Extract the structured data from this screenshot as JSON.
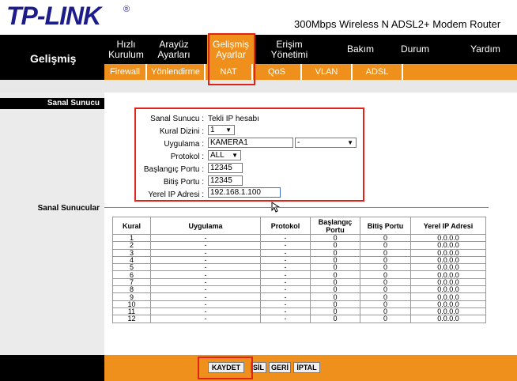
{
  "header": {
    "logo": "TP-LINK",
    "logo_mark": "®",
    "product": "300Mbps Wireless N ADSL2+ Modem Router"
  },
  "nav": {
    "section": "Gelişmiş",
    "items": [
      {
        "label": "Hızlı Kurulum"
      },
      {
        "label": "Arayüz Ayarları"
      },
      {
        "label": "Gelişmiş Ayarlar"
      },
      {
        "label": "Erişim Yönetimi"
      },
      {
        "label": "Bakım"
      },
      {
        "label": "Durum"
      },
      {
        "label": "Yardım"
      }
    ],
    "subitems": [
      {
        "label": "Firewall"
      },
      {
        "label": "Yönlendirme"
      },
      {
        "label": "NAT"
      },
      {
        "label": "QoS"
      },
      {
        "label": "VLAN"
      },
      {
        "label": "ADSL"
      }
    ]
  },
  "form": {
    "section_title": "Sanal Sunucu",
    "mode_label": "Sanal Sunucu :",
    "mode_value": "Tekli IP hesabı",
    "rule_label": "Kural Dizini :",
    "rule_value": "1",
    "app_label": "Uygulama :",
    "app_value": "KAMERA1",
    "app_select_value": "-",
    "protocol_label": "Protokol :",
    "protocol_value": "ALL",
    "start_port_label": "Başlangıç Portu :",
    "start_port_value": "12345",
    "end_port_label": "Bitiş Portu :",
    "end_port_value": "12345",
    "local_ip_label": "Yerel IP Adresi :",
    "local_ip_value": "192.168.1.100"
  },
  "table": {
    "section_title": "Sanal Sunucular",
    "headers": [
      "Kural",
      "Uygulama",
      "Protokol",
      "Başlangıç Portu",
      "Bitiş Portu",
      "Yerel IP Adresi"
    ],
    "rows": [
      [
        "1",
        "-",
        "-",
        "0",
        "0",
        "0.0.0.0"
      ],
      [
        "2",
        "-",
        "-",
        "0",
        "0",
        "0.0.0.0"
      ],
      [
        "3",
        "-",
        "-",
        "0",
        "0",
        "0.0.0.0"
      ],
      [
        "4",
        "-",
        "-",
        "0",
        "0",
        "0.0.0.0"
      ],
      [
        "5",
        "-",
        "-",
        "0",
        "0",
        "0.0.0.0"
      ],
      [
        "6",
        "-",
        "-",
        "0",
        "0",
        "0.0.0.0"
      ],
      [
        "7",
        "-",
        "-",
        "0",
        "0",
        "0.0.0.0"
      ],
      [
        "8",
        "-",
        "-",
        "0",
        "0",
        "0.0.0.0"
      ],
      [
        "9",
        "-",
        "-",
        "0",
        "0",
        "0.0.0.0"
      ],
      [
        "10",
        "-",
        "-",
        "0",
        "0",
        "0.0.0.0"
      ],
      [
        "11",
        "-",
        "-",
        "0",
        "0",
        "0.0.0.0"
      ],
      [
        "12",
        "-",
        "-",
        "0",
        "0",
        "0.0.0.0"
      ]
    ]
  },
  "footer": {
    "save": "KAYDET",
    "delete": "SİL",
    "back": "GERİ",
    "cancel": "İPTAL"
  },
  "colors": {
    "accent": "#f0901c",
    "highlight": "#e0231b",
    "brand": "#1c1c8a"
  }
}
